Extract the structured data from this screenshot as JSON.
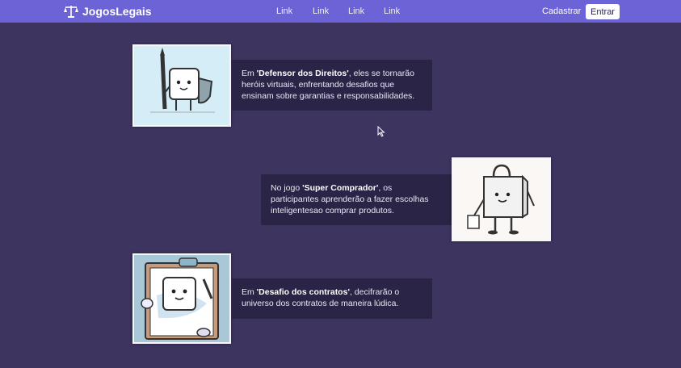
{
  "navbar": {
    "brand": "JogosLegais",
    "links": [
      "Link",
      "Link",
      "Link",
      "Link"
    ],
    "signup": "Cadastrar",
    "login": "Entrar"
  },
  "games": [
    {
      "prefix": "Em ",
      "title": "'Defensor dos Direitos'",
      "suffix": ", eles se tornarão heróis virtuais, enfrentando desafios que ensinam sobre garantias e responsabilidades.",
      "image_icon": "cube-knight-with-pen-and-shield-icon"
    },
    {
      "prefix": "No jogo ",
      "title": "'Super Comprador'",
      "suffix": ", os participantes aprenderão a fazer escolhas inteligentesao comprar produtos.",
      "image_icon": "shopping-bag-character-icon"
    },
    {
      "prefix": "Em ",
      "title": "'Desafio dos contratos'",
      "suffix": ", decifrarão o universo dos contratos de maneira lúdica.",
      "image_icon": "cube-on-clipboard-contract-icon"
    }
  ],
  "colors": {
    "background": "#3d3560",
    "navbar": "#6b63d6",
    "text_box": "#2a2446"
  }
}
